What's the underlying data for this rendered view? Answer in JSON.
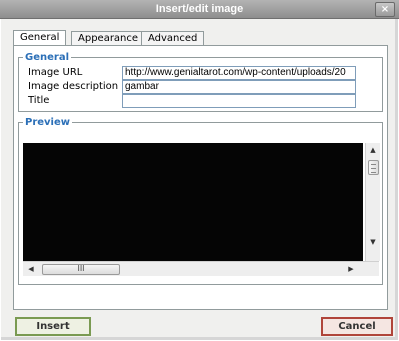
{
  "dialog": {
    "title": "Insert/edit image",
    "close_symbol": "×"
  },
  "tabs": [
    {
      "label": "General",
      "active": true
    },
    {
      "label": "Appearance",
      "active": false
    },
    {
      "label": "Advanced",
      "active": false
    }
  ],
  "general": {
    "legend": "General",
    "image_url_label": "Image URL",
    "image_url_value": "http://www.genialtarot.com/wp-content/uploads/20",
    "image_description_label": "Image description",
    "image_description_value": "gambar",
    "title_label": "Title",
    "title_value": ""
  },
  "preview": {
    "legend": "Preview"
  },
  "scrollbars": {
    "up_arrow": "▲",
    "down_arrow": "▼",
    "left_arrow": "◀",
    "right_arrow": "▶",
    "thumb_grip": "III"
  },
  "buttons": {
    "insert_label": "Insert",
    "cancel_label": "Cancel"
  },
  "colors": {
    "legend_text": "#2b6fb7",
    "insert_border": "#7a9a52",
    "cancel_border": "#b0453a",
    "preview_bg": "#050505"
  }
}
